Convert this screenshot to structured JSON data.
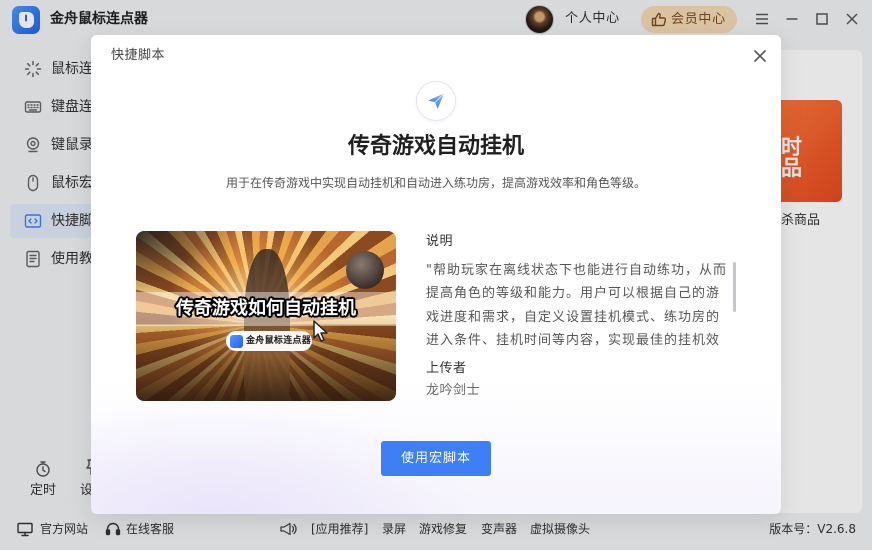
{
  "app": {
    "title": "金舟鼠标连点器",
    "logo_icon": "mouse-logo-icon"
  },
  "header": {
    "profile_label": "个人中心",
    "vip_label": "会员中心",
    "vip_icon": "thumbs-up-icon"
  },
  "sidebar": {
    "items": [
      {
        "label": "鼠标连",
        "icon": "sparkle-icon"
      },
      {
        "label": "键盘连",
        "icon": "keyboard-icon"
      },
      {
        "label": "键鼠录",
        "icon": "record-icon"
      },
      {
        "label": "鼠标宏",
        "icon": "mouse-icon"
      },
      {
        "label": "快捷脚",
        "icon": "code-icon"
      },
      {
        "label": "使用教",
        "icon": "document-icon"
      }
    ],
    "bottom": [
      {
        "label": "定时",
        "icon": "clock-icon"
      },
      {
        "label": "设",
        "icon": "pin-icon"
      }
    ]
  },
  "promo": {
    "banner_lines": [
      "时",
      "品"
    ],
    "caption": "杀商品"
  },
  "dialog": {
    "header": "快捷脚本",
    "icon": "paper-plane-icon",
    "title": "传奇游戏自动挂机",
    "subtitle": "用于在传奇游戏中实现自动挂机和自动进入练功房，提高游戏效率和角色等级。",
    "thumbnail": {
      "headline": "传奇游戏如何自动挂机",
      "brand": "金舟鼠标连点器"
    },
    "description_label": "说明",
    "description_lines": [
      "\"帮助玩家在离线状态下也能进行自动练功，从而",
      "提高角色的等级和能力。用户可以根据自己的游",
      "戏进度和需求，自定义设置挂机模式、练功房的",
      "进入条件、挂机时间等内容，实现最佳的挂机效"
    ],
    "uploader_label": "上传者",
    "uploader": "龙吟剑士",
    "action_label": "使用宏脚本"
  },
  "footer": {
    "links": [
      {
        "label": "官方网站",
        "icon": "monitor-icon"
      },
      {
        "label": "在线客服",
        "icon": "headset-icon"
      }
    ],
    "recommend_icon": "megaphone-icon",
    "recommend": [
      "[应用推荐]",
      "录屏",
      "游戏修复",
      "变声器",
      "虚拟摄像头"
    ],
    "version": "版本号：V2.6.8"
  },
  "colors": {
    "accent": "#3e7ff7",
    "vip_bg": "#f3dab6",
    "vip_text": "#7b4c22",
    "promo_bg": "#e7491f",
    "active_item_bg": "#e1e9f8",
    "overlay": "rgba(0,0,0,0.1)"
  }
}
